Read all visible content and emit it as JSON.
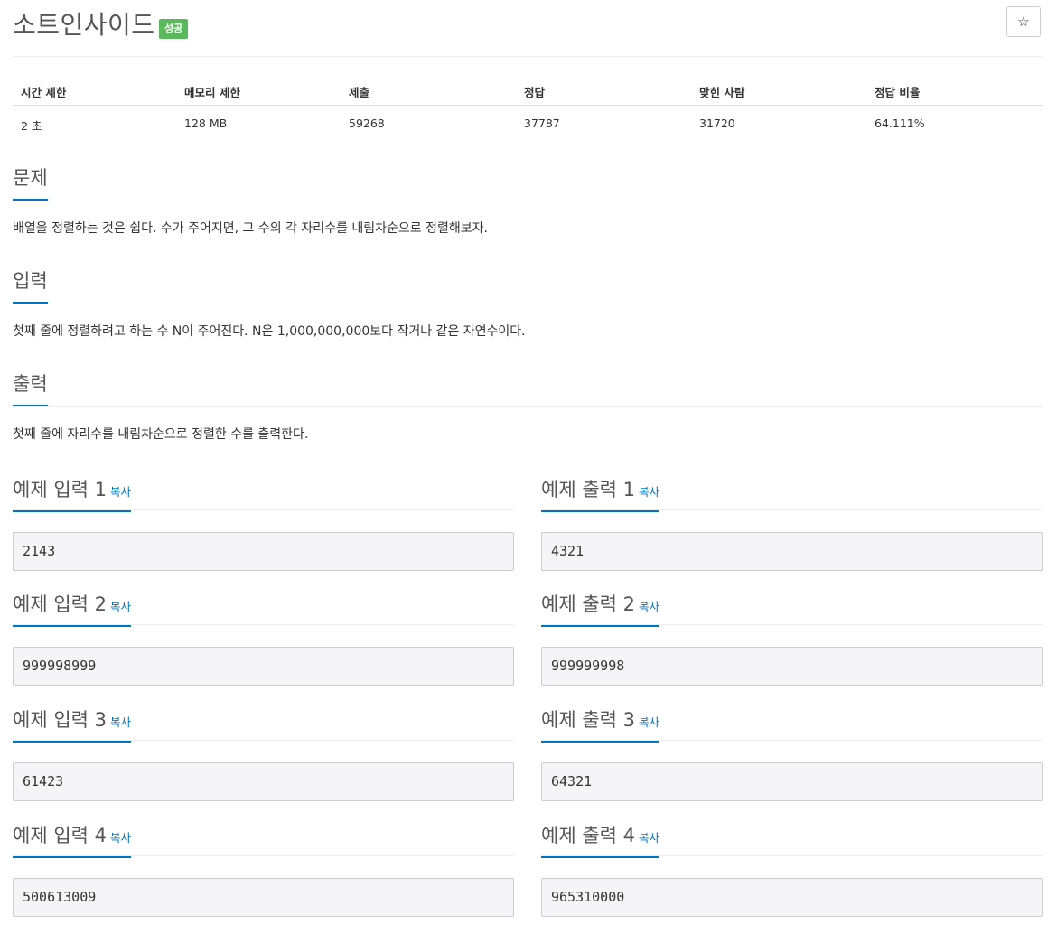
{
  "problem": {
    "title": "소트인사이드",
    "badge": "성공",
    "badge_color": "#5cb85c",
    "accent_color": "#0076c0",
    "star_icon": "star-icon"
  },
  "info": {
    "headers": [
      "시간 제한",
      "메모리 제한",
      "제출",
      "정답",
      "맞힌 사람",
      "정답 비율"
    ],
    "values": [
      "2 초",
      "128 MB",
      "59268",
      "37787",
      "31720",
      "64.111%"
    ]
  },
  "sections": {
    "problem": {
      "title": "문제",
      "text": "배열을 정렬하는 것은 쉽다. 수가 주어지면, 그 수의 각 자리수를 내림차순으로 정렬해보자."
    },
    "input": {
      "title": "입력",
      "text": "첫째 줄에 정렬하려고 하는 수 N이 주어진다. N은 1,000,000,000보다 작거나 같은 자연수이다."
    },
    "output": {
      "title": "출력",
      "text": "첫째 줄에 자리수를 내림차순으로 정렬한 수를 출력한다."
    }
  },
  "copy_label": "복사",
  "examples": [
    {
      "in_title": "예제 입력 1",
      "in_value": "2143",
      "out_title": "예제 출력 1",
      "out_value": "4321"
    },
    {
      "in_title": "예제 입력 2",
      "in_value": "999998999",
      "out_title": "예제 출력 2",
      "out_value": "999999998"
    },
    {
      "in_title": "예제 입력 3",
      "in_value": "61423",
      "out_title": "예제 출력 3",
      "out_value": "64321"
    },
    {
      "in_title": "예제 입력 4",
      "in_value": "500613009",
      "out_title": "예제 출력 4",
      "out_value": "965310000"
    }
  ]
}
